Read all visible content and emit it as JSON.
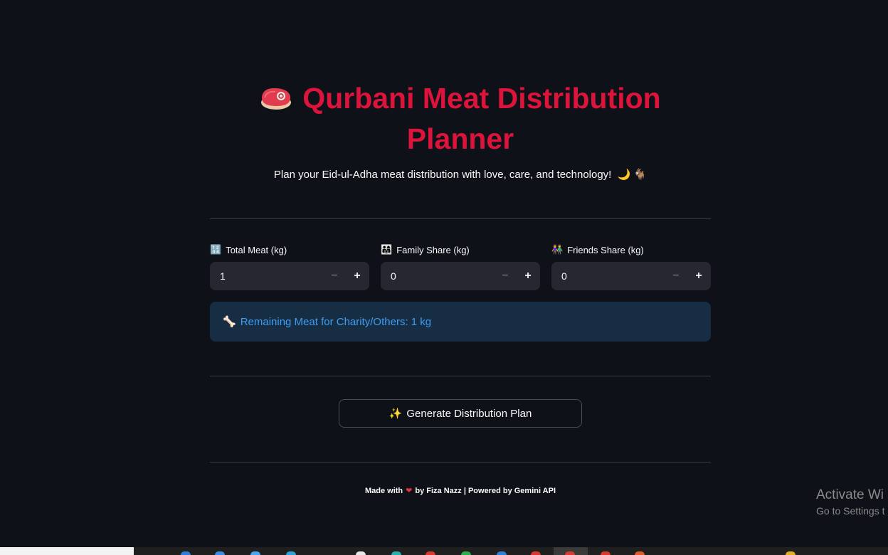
{
  "header": {
    "title": "Qurbani Meat Distribution Planner",
    "title_icon": "meat-icon",
    "subtitle": "Plan your Eid-ul-Adha meat distribution with love, care, and technology!",
    "subtitle_emojis": "🌙 🐐"
  },
  "inputs": [
    {
      "icon": "🔢",
      "label": "Total Meat (kg)",
      "value": "1"
    },
    {
      "icon": "👨‍👩‍👧",
      "label": "Family Share (kg)",
      "value": "0"
    },
    {
      "icon": "👫",
      "label": "Friends Share (kg)",
      "value": "0"
    }
  ],
  "stepper": {
    "minus": "−",
    "plus": "+"
  },
  "info": {
    "icon": "🦴",
    "text": "Remaining Meat for Charity/Others: 1 kg"
  },
  "generate_button": {
    "icon": "✨",
    "label": "Generate Distribution Plan"
  },
  "footer": {
    "made_with": "Made with",
    "heart": "❤",
    "credit": "by Fiza Nazz | Powered by Gemini API"
  },
  "watermark": {
    "line1": "Activate Wi",
    "line2": "Go to Settings t"
  },
  "colors": {
    "background": "#0e1117",
    "title": "#dc143c",
    "input_bg": "#262730",
    "info_bg": "#172d43",
    "info_text": "#3d9df3"
  }
}
